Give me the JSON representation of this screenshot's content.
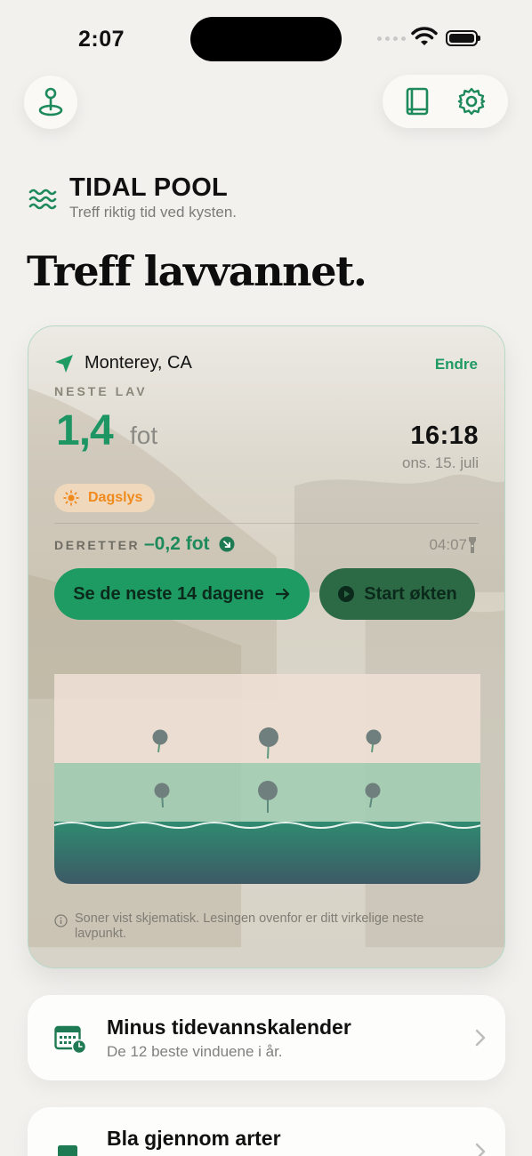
{
  "status_bar": {
    "time": "2:07"
  },
  "brand": {
    "title": "TIDAL POOL",
    "subtitle": "Treff riktig tid ved kysten."
  },
  "hero": {
    "title": "Treff lavvannet."
  },
  "card": {
    "location": "Monterey, CA",
    "change_label": "Endre",
    "next_label": "NESTE LAV",
    "height_value": "1,4",
    "height_unit": "fot",
    "time": "16:18",
    "date": "ons. 15. juli",
    "daylight_label": "Dagslys",
    "after_label": "DERETTER",
    "after_value": "–0,2 fot",
    "after_time": "04:07",
    "primary_button": "Se de neste 14 dagene",
    "secondary_button": "Start økten",
    "note": "Soner vist skjematisk. Lesingen ovenfor er ditt virkelige neste lavpunkt."
  },
  "list": [
    {
      "title": "Minus tidevannskalender",
      "subtitle": "De 12 beste vinduene i år.",
      "icon": "calendar-icon"
    },
    {
      "title": "Bla gjennom arter",
      "subtitle": "",
      "icon": "book-icon"
    }
  ],
  "colors": {
    "accent": "#1e9a63",
    "accent_dark": "#2c6a45",
    "daylight": "#f08a1d",
    "background": "#f3f1ee"
  }
}
